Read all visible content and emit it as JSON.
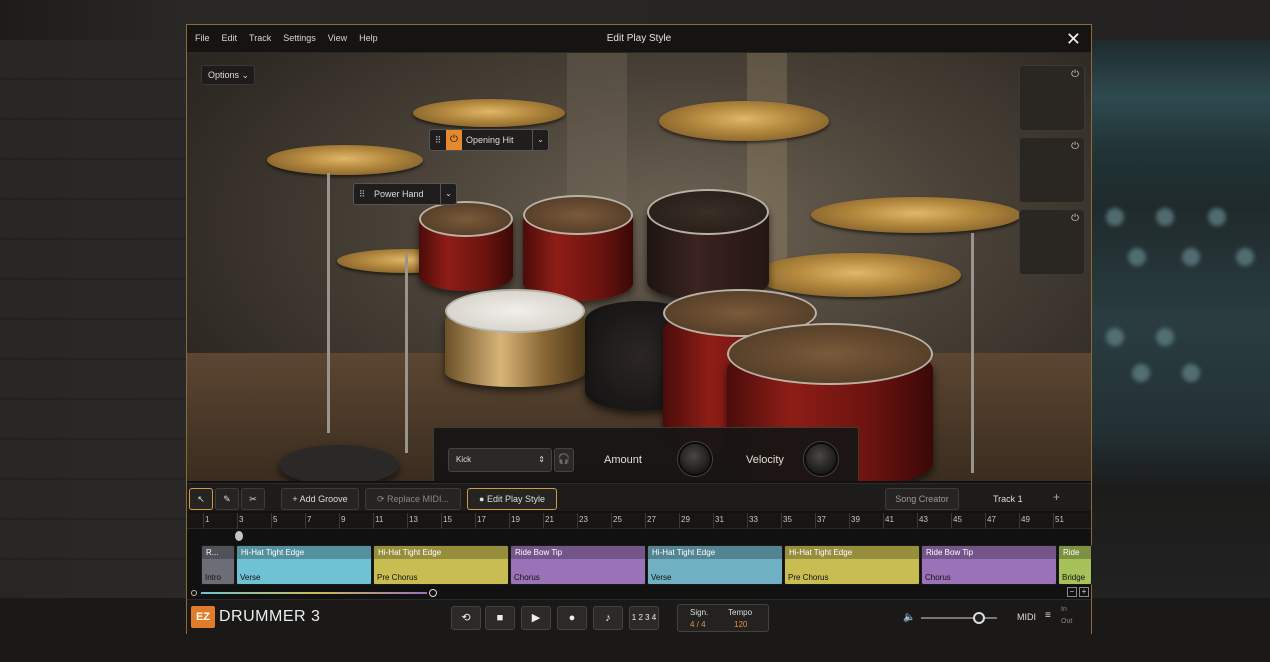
{
  "window": {
    "title": "Edit Play Style",
    "close_icon": "close-icon"
  },
  "menu": [
    "File",
    "Edit",
    "Track",
    "Settings",
    "View",
    "Help"
  ],
  "stage": {
    "options_label": "Options",
    "tooltips": {
      "opening_hit": "Opening Hit",
      "power_hand": "Power Hand"
    },
    "controls": {
      "instrument_value": "Kick",
      "amount_label": "Amount",
      "velocity_label": "Velocity"
    }
  },
  "toolbar": {
    "add_groove": "Add Groove",
    "replace_midi": "Replace MIDI...",
    "edit_play_style": "Edit Play Style",
    "song_creator": "Song Creator",
    "track_name": "Track 1",
    "add_track": "+"
  },
  "ruler": [
    "1",
    "3",
    "5",
    "7",
    "9",
    "11",
    "13",
    "15",
    "17",
    "19",
    "21",
    "23",
    "25",
    "27",
    "29",
    "31",
    "33",
    "35",
    "37",
    "39",
    "41",
    "43",
    "45",
    "47",
    "49",
    "51"
  ],
  "clips": [
    {
      "title": "R...",
      "section": "Intro",
      "color": "#6d6d78"
    },
    {
      "title": "Hi-Hat Tight Edge",
      "section": "Verse",
      "color": "#6fc2d4"
    },
    {
      "title": "Hi-Hat Tight Edge",
      "section": "Pre Chorus",
      "color": "#c8bd52"
    },
    {
      "title": "Ride Bow Tip",
      "section": "Chorus",
      "color": "#9a72b8"
    },
    {
      "title": "Hi-Hat Tight Edge",
      "section": "Verse",
      "color": "#6fb0c2"
    },
    {
      "title": "Hi-Hat Tight Edge",
      "section": "Pre Chorus",
      "color": "#c8bd52"
    },
    {
      "title": "Ride Bow Tip",
      "section": "Chorus",
      "color": "#9a72b8"
    },
    {
      "title": "Ride",
      "section": "Bridge",
      "color": "#a7c25a"
    }
  ],
  "transport": {
    "logo_ez": "EZ",
    "logo_text": "DRUMMER 3",
    "count_in": "1 2 3 4",
    "sign_label": "Sign.",
    "sign_value": "4 / 4",
    "tempo_label": "Tempo",
    "tempo_value": "120",
    "midi_label": "MIDI",
    "in_label": "In",
    "out_label": "Out"
  }
}
